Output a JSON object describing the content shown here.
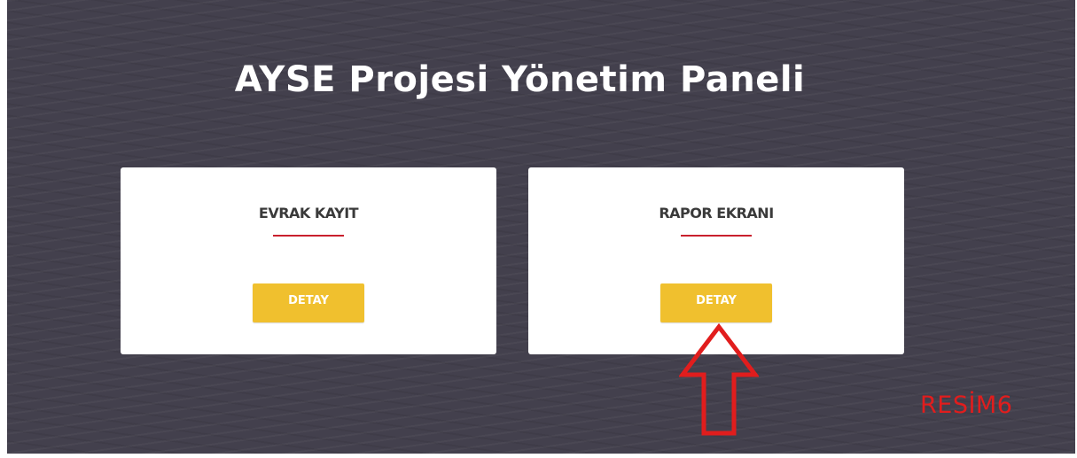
{
  "page": {
    "title": "AYSE Projesi Yönetim Paneli"
  },
  "cards": [
    {
      "title": "EVRAK KAYIT",
      "button_label": "DETAY"
    },
    {
      "title": "RAPOR EKRANI",
      "button_label": "DETAY"
    }
  ],
  "annotation": {
    "label": "RESİM6",
    "arrow_icon": "up-arrow-icon",
    "color": "#e11d1d"
  },
  "colors": {
    "background": "#43404d",
    "card": "#ffffff",
    "accent_line": "#c9202d",
    "button": "#f0c02e"
  }
}
